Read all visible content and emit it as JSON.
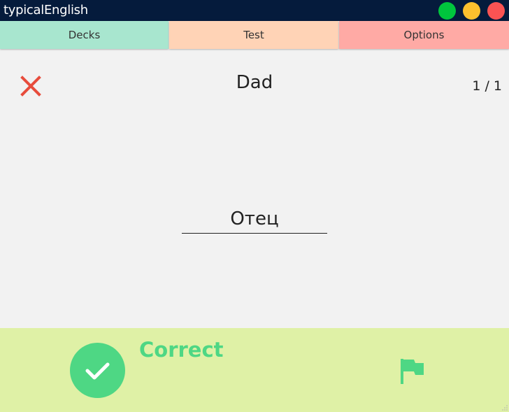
{
  "window": {
    "title": "typicalEnglish"
  },
  "tabs": [
    {
      "label": "Decks"
    },
    {
      "label": "Test"
    },
    {
      "label": "Options"
    }
  ],
  "card": {
    "word": "Dad",
    "counter": "1 / 1",
    "answer_value": "Отец"
  },
  "result": {
    "label": "Correct",
    "icon": "check-circle-icon"
  },
  "colors": {
    "titlebar": "#051b3c",
    "tab_decks": "#a8e6cf",
    "tab_test": "#ffd3b6",
    "tab_options": "#ffaaa5",
    "result_bg": "#dff1a6",
    "correct": "#4ed784",
    "close_x": "#e74c3c"
  }
}
